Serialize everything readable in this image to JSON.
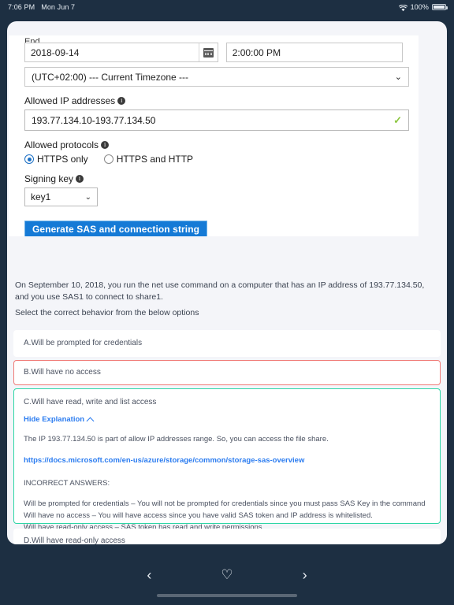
{
  "statusbar": {
    "time": "7:06 PM",
    "date": "Mon Jun 7",
    "battery_percent": "100%",
    "wifi_icon": "wifi-icon",
    "battery_icon": "battery-icon"
  },
  "form": {
    "clipped_label": "End",
    "date_value": "2018-09-14",
    "calendar_icon": "calendar-icon",
    "time_value": "2:00:00 PM",
    "timezone_value": "(UTC+02:00) --- Current Timezone ---",
    "timezone_chevron": "chevron-down-icon",
    "allowed_ip_label": "Allowed IP addresses",
    "allowed_ip_value": "193.77.134.10-193.77.134.50",
    "valid_icon": "checkmark-icon",
    "allowed_protocols_label": "Allowed protocols",
    "protocol_options": [
      "HTTPS only",
      "HTTPS and HTTP"
    ],
    "protocol_selected": "HTTPS only",
    "signing_key_label": "Signing key",
    "signing_key_value": "key1",
    "signing_key_chevron": "chevron-down-icon",
    "generate_button": "Generate SAS and connection string",
    "info_icon": "info-icon",
    "button_color": "#157ad6"
  },
  "question": {
    "scenario": "On September 10, 2018, you run the net use command on a computer that has an IP address of 193.77.134.50, and you use SAS1 to connect to share1.",
    "prompt": "Select the correct behavior from the below options"
  },
  "options": [
    {
      "id": "a",
      "label": "A.Will be prompted for credentials",
      "state": "neutral"
    },
    {
      "id": "b",
      "label": "B.Will have no access",
      "state": "incorrect",
      "border_color": "#f07b77"
    },
    {
      "id": "c",
      "label": "C.Will have read, write and list access",
      "state": "correct",
      "border_color": "#2ed6a6"
    },
    {
      "id": "d",
      "label": "D.Will have read-only access",
      "state": "neutral"
    }
  ],
  "explanation": {
    "toggle_label": "Hide Explanation",
    "toggle_icon": "chevron-up-icon",
    "text": "The IP 193.77.134.50 is part of allow IP addresses range. So, you can access the file share.",
    "link": "https://docs.microsoft.com/en-us/azure/storage/common/storage-sas-overview",
    "incorrect_header": "INCORRECT ANSWERS:",
    "incorrect_items": [
      "Will be prompted for credentials – You will not be prompted for credentials since you must pass SAS Key in the command",
      "Will have no access – You will have access since you have valid SAS token and IP address is whitelisted.",
      "Will have read-only access – SAS token has read and write permissions."
    ],
    "link_color": "#2b7cf0"
  },
  "bottomnav": {
    "back_icon": "chevron-left-icon",
    "favorite_icon": "heart-icon",
    "forward_icon": "chevron-right-icon",
    "back_glyph": "‹",
    "favorite_glyph": "♡",
    "forward_glyph": "›"
  }
}
